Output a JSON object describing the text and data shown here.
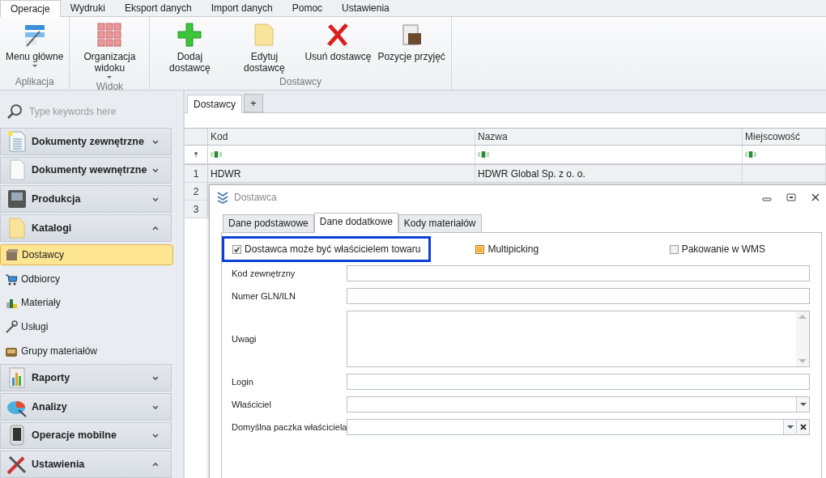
{
  "ribbon": {
    "tabs": [
      {
        "label": "Operacje",
        "selected": true
      },
      {
        "label": "Wydruki",
        "selected": false
      },
      {
        "label": "Eksport danych",
        "selected": false
      },
      {
        "label": "Import danych",
        "selected": false
      },
      {
        "label": "Pomoc",
        "selected": false
      },
      {
        "label": "Ustawienia",
        "selected": false
      }
    ],
    "groups": [
      {
        "title": "Aplikacja",
        "buttons": [
          {
            "kind": "menu",
            "label": "Menu główne",
            "dropdown": true
          }
        ]
      },
      {
        "title": "Widok",
        "buttons": [
          {
            "kind": "grid",
            "label": "Organizacja widoku",
            "dropdown": true
          }
        ]
      },
      {
        "title": "Dostawcy",
        "buttons": [
          {
            "kind": "add",
            "label": "Dodaj dostawcę",
            "dropdown": false
          },
          {
            "kind": "edit",
            "label": "Edytuj dostawcę",
            "dropdown": false
          },
          {
            "kind": "delete",
            "label": "Usuń dostawcę",
            "dropdown": false
          },
          {
            "kind": "clipboard",
            "label": "Pozycje przyjęć",
            "dropdown": false
          }
        ]
      }
    ]
  },
  "sidebar": {
    "search": {
      "placeholder": "Type keywords here"
    },
    "groups": [
      {
        "kind": "document",
        "label": "Dokumenty zewnętrzne",
        "expanded": false
      },
      {
        "kind": "page",
        "label": "Dokumenty wewnętrzne",
        "expanded": false
      },
      {
        "kind": "machine",
        "label": "Produkcja",
        "expanded": false
      },
      {
        "kind": "folder",
        "label": "Katalogi",
        "expanded": true,
        "children": [
          {
            "kind": "box",
            "label": "Dostawcy",
            "selected": true
          },
          {
            "kind": "cart",
            "label": "Odbiorcy",
            "selected": false
          },
          {
            "kind": "materials",
            "label": "Materiały",
            "selected": false
          },
          {
            "kind": "wrench",
            "label": "Usługi",
            "selected": false
          },
          {
            "kind": "chest",
            "label": "Grupy materiałów",
            "selected": false
          }
        ]
      },
      {
        "kind": "report",
        "label": "Raporty",
        "expanded": false
      },
      {
        "kind": "analysis",
        "label": "Analizy",
        "expanded": false
      },
      {
        "kind": "phone",
        "label": "Operacje mobilne",
        "expanded": false
      },
      {
        "kind": "tools",
        "label": "Ustawienia",
        "expanded": true
      }
    ]
  },
  "document_tabs": [
    {
      "label": "Dostawcy"
    }
  ],
  "add_tab": "+",
  "table": {
    "columns": [
      "Kod",
      "Nazwa",
      "Miejscowość"
    ],
    "rows": [
      {
        "number": "1",
        "cells": [
          "HDWR",
          "HDWR Global Sp. z o. o.",
          ""
        ]
      },
      {
        "number": "2",
        "cells": [
          "",
          "",
          ""
        ]
      },
      {
        "number": "3",
        "cells": [
          "",
          "",
          ""
        ]
      }
    ]
  },
  "dialog": {
    "title": "Dostawca",
    "tabs": [
      {
        "label": "Dane podstawowe",
        "selected": false
      },
      {
        "label": "Dane dodatkowe",
        "selected": true
      },
      {
        "label": "Kody materiałów",
        "selected": false
      }
    ],
    "checkboxes": [
      {
        "label": "Dostawca może być właścicielem towaru",
        "checked": true,
        "indeterminate": false,
        "highlighted": true
      },
      {
        "label": "Multipicking",
        "checked": false,
        "indeterminate": true,
        "highlighted": false
      },
      {
        "label": "Pakowanie w WMS",
        "checked": false,
        "indeterminate": false,
        "highlighted": false
      }
    ],
    "fields": [
      {
        "kind": "text",
        "label": "Kod zewnętrzny"
      },
      {
        "kind": "text",
        "label": "Numer GLN/ILN"
      },
      {
        "kind": "textarea",
        "label": "Uwagi"
      },
      {
        "kind": "text",
        "label": "Login"
      },
      {
        "kind": "combo",
        "label": "Właściciel"
      },
      {
        "kind": "combo-clear",
        "label": "Domyślna paczka właściciela"
      }
    ]
  }
}
